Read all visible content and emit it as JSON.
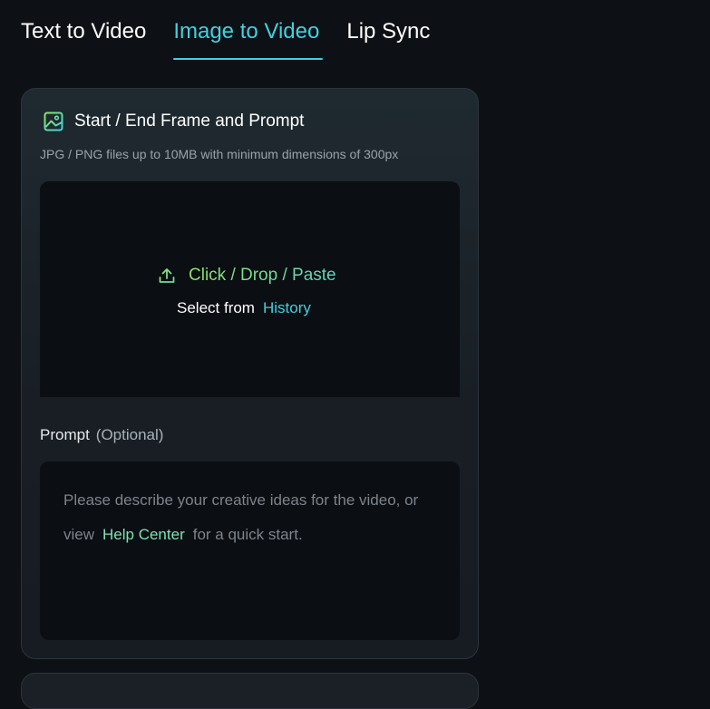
{
  "tabs": [
    {
      "label": "Text to Video",
      "active": false
    },
    {
      "label": "Image to Video",
      "active": true
    },
    {
      "label": "Lip Sync",
      "active": false
    }
  ],
  "card": {
    "title": "Start / End Frame and Prompt",
    "icon": "image-icon",
    "subtitle": "JPG / PNG files up to 10MB with minimum dimensions of 300px",
    "upload": {
      "icon": "upload-icon",
      "action_text": "Click / Drop / Paste",
      "select_prefix": "Select from",
      "history_link": "History"
    },
    "prompt": {
      "label": "Prompt",
      "optional": "(Optional)",
      "placeholder_before": "Please describe your creative ideas for the video, or view",
      "help_link": "Help Center",
      "placeholder_after": "for a quick start."
    }
  },
  "colors": {
    "accent": "#3fd2e0",
    "background": "#0d1015",
    "card_bg": "#1c252b",
    "green": "#8fe36a"
  }
}
